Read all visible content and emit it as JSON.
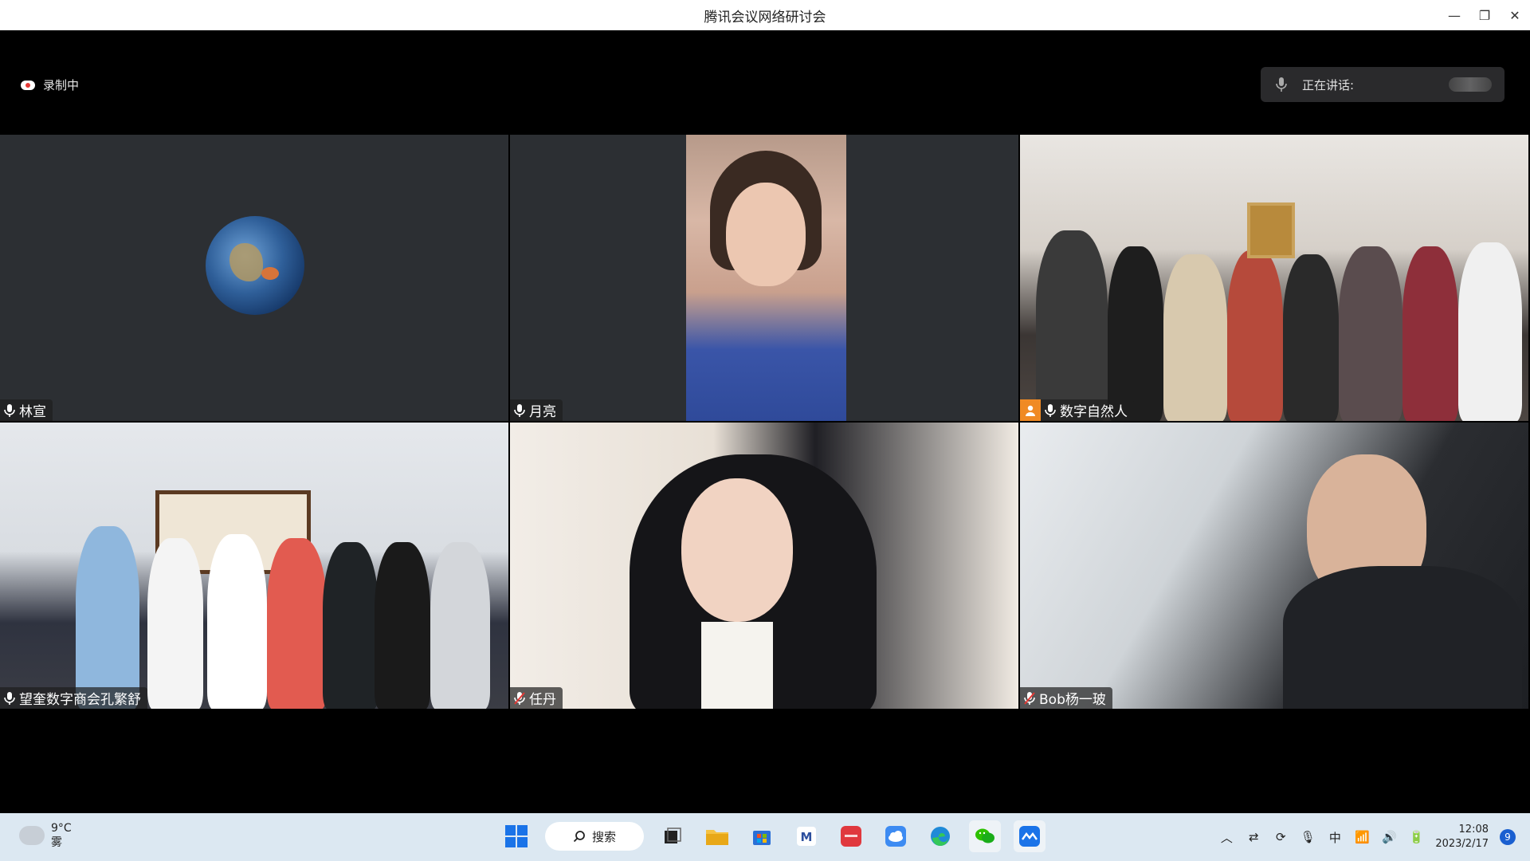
{
  "window": {
    "title": "腾讯会议网络研讨会",
    "minimize": "—",
    "restore": "❐",
    "close": "✕"
  },
  "header": {
    "recording_label": "录制中",
    "speaking_label": "正在讲话:"
  },
  "participants": [
    {
      "name": "林宣",
      "mic": "on",
      "video": "avatar"
    },
    {
      "name": "月亮",
      "mic": "on",
      "video": "camera"
    },
    {
      "name": "数字自然人",
      "mic": "on",
      "video": "camera",
      "host_badge": true
    },
    {
      "name": "望奎数字商会孔繁舒",
      "mic": "on",
      "video": "camera"
    },
    {
      "name": "任丹",
      "mic": "muted",
      "video": "camera"
    },
    {
      "name": "Bob杨一玻",
      "mic": "muted",
      "video": "camera"
    }
  ],
  "taskbar": {
    "weather": {
      "temp": "9°C",
      "condition": "雾"
    },
    "search_label": "搜索",
    "apps": [
      "task-view",
      "file-explorer",
      "microsoft-store",
      "app-m",
      "huawei-app",
      "cloud-app",
      "edge",
      "wechat",
      "tencent-meeting"
    ],
    "tray": {
      "ime": "中",
      "time": "12:08",
      "date": "2023/2/17",
      "notifications": "9"
    }
  },
  "colors": {
    "accent": "#1a73e8",
    "muted_mic": "#e53935",
    "host_badge": "#f08a24"
  }
}
